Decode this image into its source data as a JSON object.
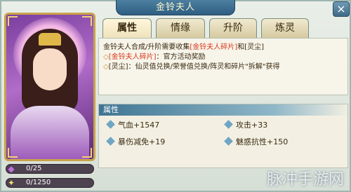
{
  "window": {
    "title": "金铃夫人",
    "close_symbol": "×"
  },
  "tabs": [
    {
      "label": "属性",
      "active": true
    },
    {
      "label": "情缘",
      "active": false
    },
    {
      "label": "升阶",
      "active": false
    },
    {
      "label": "炼灵",
      "active": false
    }
  ],
  "description": {
    "line1_prefix": "金铃夫人合成/升阶需要收集",
    "line1_item": "[金铃夫人碎片]",
    "line1_mid": "和",
    "line1_item2": "[灵尘]",
    "line2_bullet": "◇",
    "line2_item": "[金铃夫人碎片]",
    "line2_rest": "：官方活动奖励",
    "line3_bullet": "◇",
    "line3_text": "[灵尘]：仙灵值兑换/荣誉值兑换/阵灵和碎片\"拆解\"获得"
  },
  "attributes": {
    "header": "属性",
    "items": [
      {
        "label": "气血+1547"
      },
      {
        "label": "攻击+33"
      },
      {
        "label": "暴伤减免+19"
      },
      {
        "label": "魅惑抗性+150"
      }
    ]
  },
  "progress": [
    {
      "icon": "gem-icon",
      "text": "0/25",
      "value": 0,
      "max": 25
    },
    {
      "icon": "dust-icon",
      "text": "0/1250",
      "value": 0,
      "max": 1250
    }
  ],
  "watermark": "脉冲手游网",
  "colors": {
    "highlight": "#d8381a",
    "title_bg": "#2f5f82",
    "frame_gold": "#c9a24a"
  }
}
